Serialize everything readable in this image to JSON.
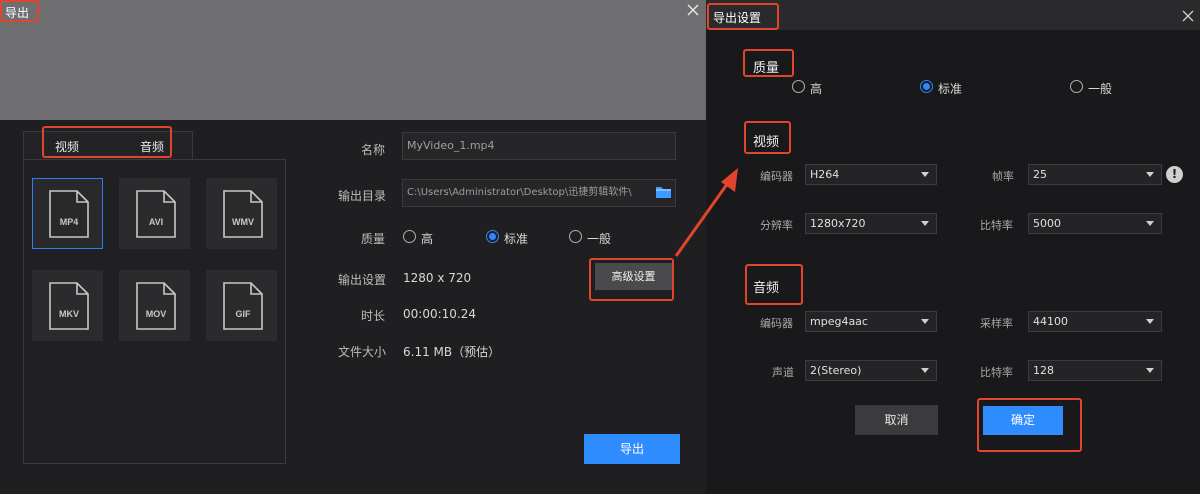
{
  "left": {
    "title": "导出",
    "tabs": [
      {
        "label": "视频"
      },
      {
        "label": "音频"
      }
    ],
    "formats": [
      {
        "label": "MP4",
        "selected": true
      },
      {
        "label": "AVI",
        "selected": false
      },
      {
        "label": "WMV",
        "selected": false
      },
      {
        "label": "MKV",
        "selected": false
      },
      {
        "label": "MOV",
        "selected": false
      },
      {
        "label": "GIF",
        "selected": false
      }
    ],
    "fields": {
      "name_label": "名称",
      "name_value": "MyVideo_1.mp4",
      "dir_label": "输出目录",
      "dir_value": "C:\\Users\\Administrator\\Desktop\\迅捷剪辑软件\\",
      "quality_label": "质量",
      "quality_options": [
        "高",
        "标准",
        "一般"
      ],
      "quality_selected": "标准",
      "output_label": "输出设置",
      "output_value": "1280 x 720",
      "advanced_button": "高级设置",
      "duration_label": "时长",
      "duration_value": "00:00:10.24",
      "size_label": "文件大小",
      "size_value": "6.11 MB（预估）"
    },
    "export_button": "导出"
  },
  "right": {
    "title": "导出设置",
    "quality": {
      "title": "质量",
      "options": [
        "高",
        "标准",
        "一般"
      ],
      "selected": "标准"
    },
    "video": {
      "title": "视频",
      "encoder_label": "编码器",
      "encoder_value": "H264",
      "framerate_label": "帧率",
      "framerate_value": "25",
      "resolution_label": "分辨率",
      "resolution_value": "1280x720",
      "bitrate_label": "比特率",
      "bitrate_value": "5000"
    },
    "audio": {
      "title": "音频",
      "encoder_label": "编码器",
      "encoder_value": "mpeg4aac",
      "samplerate_label": "采样率",
      "samplerate_value": "44100",
      "channel_label": "声道",
      "channel_value": "2(Stereo)",
      "bitrate_label": "比特率",
      "bitrate_value": "128"
    },
    "cancel_button": "取消",
    "ok_button": "确定"
  },
  "colors": {
    "accent": "#2f8cff",
    "annotation": "#e2452c"
  }
}
